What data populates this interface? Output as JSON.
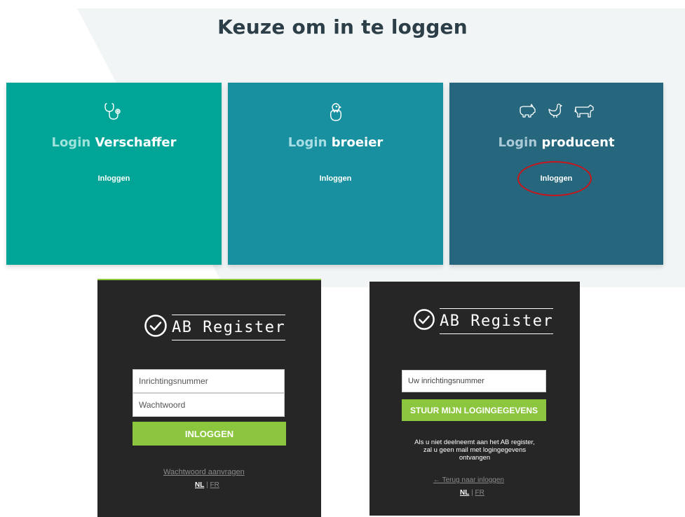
{
  "page": {
    "title": "Keuze om in te loggen"
  },
  "cards": [
    {
      "title_light": "Login",
      "title_bold": "Verschaffer",
      "link": "Inloggen",
      "icons": [
        "stethoscope-icon"
      ]
    },
    {
      "title_light": "Login",
      "title_bold": "broeier",
      "link": "Inloggen",
      "icons": [
        "hatching-chick-icon"
      ]
    },
    {
      "title_light": "Login",
      "title_bold": "producent",
      "link": "Inloggen",
      "icons": [
        "pig-icon",
        "chicken-icon",
        "cow-icon"
      ]
    }
  ],
  "colors": {
    "card_1": "#00a597",
    "card_2": "#18909f",
    "card_3": "#26677d",
    "accent_green": "#8cc63f",
    "panel_bg": "#262626",
    "highlight_red": "#c8151b"
  },
  "login_panel": {
    "logo": "AB Register",
    "username_placeholder": "Inrichtingsnummer",
    "password_placeholder": "Wachtwoord",
    "submit_label": "INLOGGEN",
    "forgot_link": "Wachtwoord aanvragen",
    "lang_nl": "NL",
    "lang_sep": "|",
    "lang_fr": "FR"
  },
  "request_panel": {
    "logo": "AB Register",
    "input_placeholder": "Uw inrichtingsnummer",
    "submit_label": "STUUR MIJN LOGINGEGEVENS",
    "info_line_1": "Als u niet deelneemt aan het AB register,",
    "info_line_2": "zal u geen mail met logingegevens",
    "info_line_3": "ontvangen",
    "back_link": "← Terug naar inloggen",
    "lang_nl": "NL",
    "lang_sep": "|",
    "lang_fr": "FR"
  }
}
